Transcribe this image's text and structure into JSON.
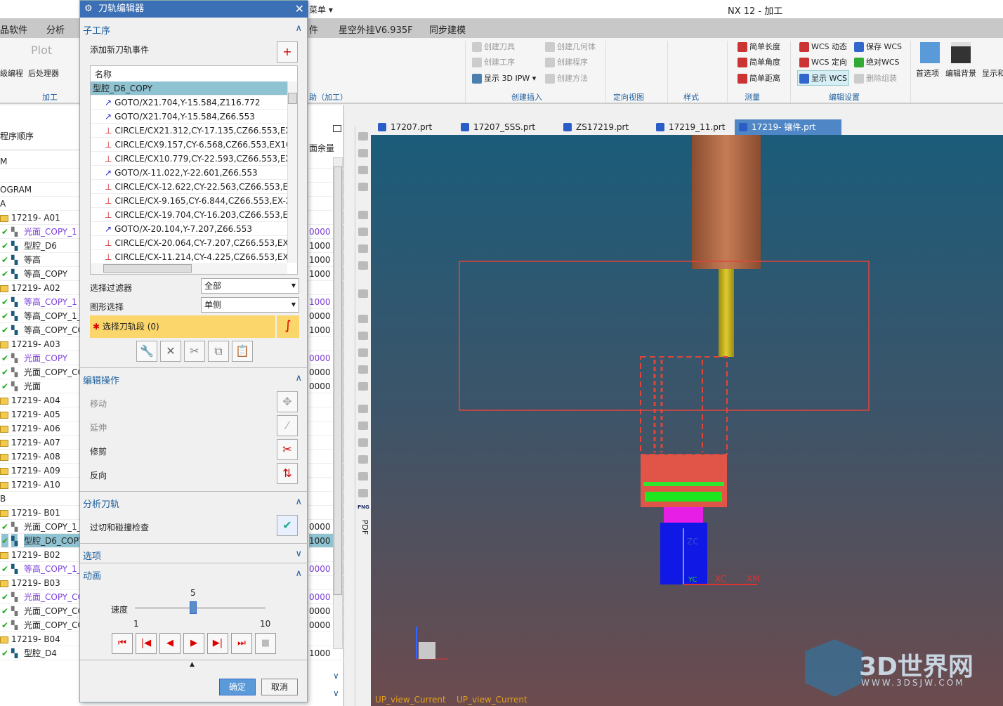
{
  "app_title": "NX 12 - 加工",
  "quick_access": {
    "menu_label": "菜单 ▾"
  },
  "menubar": [
    "品软件",
    "分析",
    "件",
    "星空外挂V6.935F",
    "同步建模"
  ],
  "ribbon": {
    "left_group": {
      "items": [
        "级编程",
        "后处理器"
      ],
      "label": "加工",
      "plot": "Plot"
    },
    "assist_group": "助（加工）",
    "insert_group": {
      "items": [
        "创建刀具",
        "创建几何体",
        "创建工序",
        "创建程序",
        "显示 3D IPW",
        "创建方法"
      ],
      "label": "创建插入"
    },
    "orient_label": "定向视图",
    "style_label": "样式",
    "measure_group": {
      "items": [
        "简单长度",
        "简单角度",
        "简单距离"
      ],
      "label": "测量"
    },
    "wcs_group": {
      "items": [
        "WCS 动态",
        "保存 WCS",
        "WCS 定向",
        "绝对WCS",
        "显示 WCS",
        "删除组装"
      ],
      "label": "编辑设置"
    },
    "right_buttons": [
      "首选项",
      "编辑背景",
      "显示和"
    ]
  },
  "tree": {
    "header": "程序顺序",
    "column_header": "面余量",
    "rows": [
      {
        "t": "text",
        "n": "M"
      },
      {
        "t": "text",
        "n": ""
      },
      {
        "t": "text",
        "n": "OGRAM"
      },
      {
        "t": "text",
        "n": "A"
      },
      {
        "t": "f",
        "n": "17219- A01"
      },
      {
        "t": "op",
        "n": "光面_COPY_1",
        "p": true,
        "v": "0000",
        "i": "face"
      },
      {
        "t": "op",
        "n": "型腔_D6",
        "v": "1000",
        "i": "mill"
      },
      {
        "t": "op",
        "n": "等高",
        "v": "1000",
        "i": "mill"
      },
      {
        "t": "op",
        "n": "等高_COPY",
        "v": "1000",
        "i": "mill"
      },
      {
        "t": "f",
        "n": "17219- A02"
      },
      {
        "t": "op",
        "n": "等高_COPY_1",
        "p": true,
        "v": "1000",
        "i": "mill"
      },
      {
        "t": "op",
        "n": "等高_COPY_1_",
        "v": "0000",
        "i": "mill"
      },
      {
        "t": "op",
        "n": "等高_COPY_CO",
        "v": "1000",
        "i": "mill"
      },
      {
        "t": "f",
        "n": "17219- A03"
      },
      {
        "t": "op",
        "n": "光面_COPY",
        "p": true,
        "v": "0000",
        "i": "face"
      },
      {
        "t": "op",
        "n": "光面_COPY_CO",
        "v": "0000",
        "i": "face"
      },
      {
        "t": "op",
        "n": "光面",
        "v": "0000",
        "i": "face"
      },
      {
        "t": "f",
        "n": "17219- A04"
      },
      {
        "t": "f",
        "n": "17219- A05"
      },
      {
        "t": "f",
        "n": "17219- A06"
      },
      {
        "t": "f",
        "n": "17219- A07"
      },
      {
        "t": "f",
        "n": "17219- A08"
      },
      {
        "t": "f",
        "n": "17219- A09"
      },
      {
        "t": "f",
        "n": "17219- A10"
      },
      {
        "t": "text",
        "n": "B"
      },
      {
        "t": "f",
        "n": "17219- B01"
      },
      {
        "t": "op",
        "n": "光面_COPY_1_",
        "v": "0000",
        "i": "face"
      },
      {
        "t": "op",
        "n": "型腔_D6_COPY",
        "v": "1000",
        "i": "mill",
        "sel": true
      },
      {
        "t": "f",
        "n": "17219- B02"
      },
      {
        "t": "op",
        "n": "等高_COPY_1_",
        "p": true,
        "v": "0000",
        "i": "mill"
      },
      {
        "t": "f",
        "n": "17219- B03"
      },
      {
        "t": "op",
        "n": "光面_COPY_CO",
        "p": true,
        "v": "0000",
        "i": "face"
      },
      {
        "t": "op",
        "n": "光面_COPY_CO",
        "v": "0000",
        "i": "face"
      },
      {
        "t": "op",
        "n": "光面_COPY_CO",
        "v": "0000",
        "i": "face"
      },
      {
        "t": "f",
        "n": "17219- B04"
      },
      {
        "t": "op",
        "n": "型腔_D4",
        "v": "1000",
        "i": "mill"
      }
    ]
  },
  "dialog": {
    "title": "刀轨编辑器",
    "subop_section": "子工序",
    "add_event": "添加新刀轨事件",
    "list_header": "名称",
    "list_selected": "型腔_D6_COPY",
    "events": [
      {
        "k": "goto",
        "t": "GOTO/X21.704,Y-15.584,Z116.772"
      },
      {
        "k": "goto",
        "t": "GOTO/X21.704,Y-15.584,Z66.553"
      },
      {
        "k": "circle",
        "t": "CIRCLE/CX21.312,CY-17.135,CZ66.553,EX2"
      },
      {
        "k": "circle",
        "t": "CIRCLE/CX9.157,CY-6.568,CZ66.553,EX10."
      },
      {
        "k": "circle",
        "t": "CIRCLE/CX10.779,CY-22.593,CZ66.553,EX9"
      },
      {
        "k": "goto",
        "t": "GOTO/X-11.022,Y-22.601,Z66.553"
      },
      {
        "k": "circle",
        "t": "CIRCLE/CX-12.622,CY-22.563,CZ66.553,EX"
      },
      {
        "k": "circle",
        "t": "CIRCLE/CX-9.165,CY-6.844,CZ66.553,EX-2"
      },
      {
        "k": "circle",
        "t": "CIRCLE/CX-19.704,CY-16.203,CZ66.553,EX"
      },
      {
        "k": "goto",
        "t": "GOTO/X-20.104,Y-7.207,Z66.553"
      },
      {
        "k": "circle",
        "t": "CIRCLE/CX-20.064,CY-7.207,CZ66.553,EX-"
      },
      {
        "k": "circle",
        "t": "CIRCLE/CX-11.214,CY-4.225,CZ66.553,EX-"
      }
    ],
    "filter_label": "选择过滤器",
    "filter_value": "全部",
    "shape_label": "图形选择",
    "shape_value": "单侧",
    "select_segment": "选择刀轨段 (0)",
    "edit_section": "编辑操作",
    "move": "移动",
    "extend": "延伸",
    "trim": "修剪",
    "reverse": "反向",
    "analyze_section": "分析刀轨",
    "gouge_check": "过切和碰撞检查",
    "options_section": "选项",
    "anim_section": "动画",
    "speed_label": "速度",
    "speed_value": "5",
    "speed_min": "1",
    "speed_max": "10",
    "ok": "确定",
    "cancel": "取消"
  },
  "tabs": [
    {
      "label": "17207.prt"
    },
    {
      "label": "17207_SSS.prt"
    },
    {
      "label": "ZS17219.prt"
    },
    {
      "label": "17219_11.prt"
    },
    {
      "label": "17219- 镶件.prt",
      "active": true
    }
  ],
  "viewport": {
    "view_label_1": "UP_view_Current",
    "view_label_2": "UP_view_Current",
    "axis_zc": "ZC",
    "axis_xc": "XC",
    "axis_xm": "XM",
    "axis_yc": "YC",
    "watermark": "3D世界网",
    "watermark_url": "WWW.3DSJW.COM",
    "png": "PNG",
    "pdf": "PDF"
  },
  "colors": {
    "title_blue": "#3b6fb6",
    "section_blue": "#1c5e9c",
    "selected": "#8fc3d2",
    "purple": "#7a3ed6",
    "tool_brown": "#b06a45",
    "path_red": "#e0453a"
  }
}
